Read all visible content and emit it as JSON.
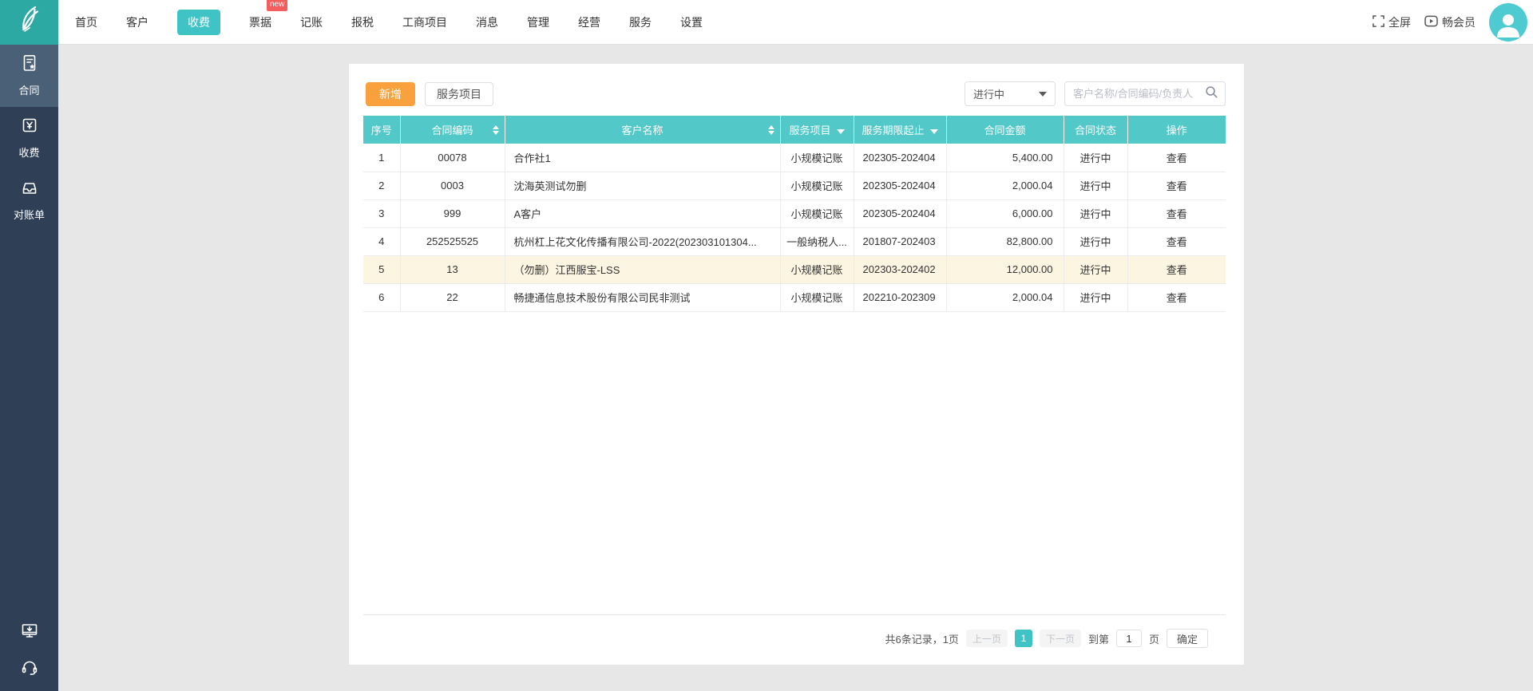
{
  "colors": {
    "accent_teal": "#3fc3c5",
    "table_header_teal": "#52c8c8",
    "logo_teal": "#2ca9a3",
    "add_button_orange": "#f9a13c",
    "sidebar_dark": "#2f4056",
    "sidebar_active": "#4a6076",
    "badge_red": "#f25e5e",
    "row_highlight": "#fcf5e2",
    "page_background": "#e7e7e7"
  },
  "topbar": {
    "nav_items": [
      {
        "label": "首页"
      },
      {
        "label": "客户"
      },
      {
        "label": "收费",
        "active": true
      },
      {
        "label": "票据",
        "badge": "new"
      },
      {
        "label": "记账"
      },
      {
        "label": "报税"
      },
      {
        "label": "工商项目"
      },
      {
        "label": "消息"
      },
      {
        "label": "管理"
      },
      {
        "label": "经营"
      },
      {
        "label": "服务"
      },
      {
        "label": "设置"
      }
    ],
    "fullscreen_label": "全屏",
    "member_label": "畅会员",
    "icons": {
      "logo": "logo-leaf-icon",
      "fullscreen": "fullscreen-icon",
      "member": "member-play-icon",
      "avatar": "avatar-user-icon"
    }
  },
  "sidebar": {
    "items": [
      {
        "label": "合同",
        "icon": "contract-icon",
        "active": true
      },
      {
        "label": "收费",
        "icon": "fee-icon"
      },
      {
        "label": "对账单",
        "icon": "statement-icon"
      }
    ],
    "bottom_icons": [
      "download-client-icon",
      "support-headset-icon"
    ]
  },
  "toolbar": {
    "add_label": "新增",
    "service_label": "服务项目",
    "status_filter_value": "进行中",
    "search_placeholder": "客户名称/合同编码/负责人",
    "search_icon": "search-icon"
  },
  "table": {
    "columns": [
      {
        "label": "序号"
      },
      {
        "label": "合同编码",
        "sort": true
      },
      {
        "label": "客户名称",
        "sort": true
      },
      {
        "label": "服务项目",
        "filter": true
      },
      {
        "label": "服务期限起止",
        "filter": true
      },
      {
        "label": "合同金额"
      },
      {
        "label": "合同状态"
      },
      {
        "label": "操作"
      }
    ],
    "rows": [
      {
        "cells": [
          "1",
          "00078",
          "合作社1",
          "小规模记账",
          "202305-202404",
          "5,400.00",
          "进行中",
          "查看"
        ]
      },
      {
        "cells": [
          "2",
          "0003",
          "沈海英测试勿删",
          "小规模记账",
          "202305-202404",
          "2,000.04",
          "进行中",
          "查看"
        ]
      },
      {
        "cells": [
          "3",
          "999",
          "A客户",
          "小规模记账",
          "202305-202404",
          "6,000.00",
          "进行中",
          "查看"
        ]
      },
      {
        "cells": [
          "4",
          "252525525",
          "杭州杠上花文化传播有限公司-2022(202303101304...",
          "一般纳税人...",
          "201807-202403",
          "82,800.00",
          "进行中",
          "查看"
        ]
      },
      {
        "cells": [
          "5",
          "13",
          "（勿删）江西服宝-LSS",
          "小规模记账",
          "202303-202402",
          "12,000.00",
          "进行中",
          "查看"
        ],
        "highlighted": true
      },
      {
        "cells": [
          "6",
          "22",
          "畅捷通信息技术股份有限公司民非测试",
          "小规模记账",
          "202210-202309",
          "2,000.04",
          "进行中",
          "查看"
        ]
      }
    ]
  },
  "pagination": {
    "summary": "共6条记录，1页",
    "prev_label": "上一页",
    "current_page": "1",
    "next_label": "下一页",
    "goto_prefix": "到第",
    "goto_value": "1",
    "goto_suffix": "页",
    "confirm_label": "确定"
  }
}
